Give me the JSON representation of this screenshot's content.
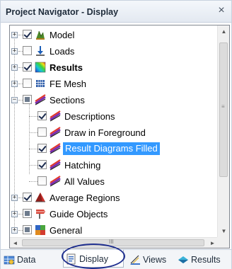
{
  "panel": {
    "title": "Project Navigator - Display",
    "close_glyph": "×"
  },
  "tree": {
    "items": [
      {
        "label": "Model",
        "state": "checked",
        "icon": "model-icon",
        "expander": "+"
      },
      {
        "label": "Loads",
        "state": "unchecked",
        "icon": "loads-icon",
        "expander": "+"
      },
      {
        "label": "Results",
        "state": "checked",
        "icon": "results-icon",
        "expander": "+"
      },
      {
        "label": "FE Mesh",
        "state": "unchecked",
        "icon": "fe-mesh-icon",
        "expander": "+"
      },
      {
        "label": "Sections",
        "state": "partial",
        "icon": "sections-icon",
        "expander": "−"
      },
      {
        "label": "Descriptions",
        "state": "checked",
        "icon": "section-item-icon"
      },
      {
        "label": "Draw in Foreground",
        "state": "unchecked",
        "icon": "section-item-icon"
      },
      {
        "label": "Result Diagrams Filled",
        "state": "checked",
        "icon": "section-item-icon",
        "selected": true
      },
      {
        "label": "Hatching",
        "state": "checked",
        "icon": "section-item-icon"
      },
      {
        "label": "All Values",
        "state": "unchecked",
        "icon": "section-item-icon"
      },
      {
        "label": "Average Regions",
        "state": "checked",
        "icon": "average-regions-icon",
        "expander": "+"
      },
      {
        "label": "Guide Objects",
        "state": "partial",
        "icon": "guide-objects-icon",
        "expander": "+"
      },
      {
        "label": "General",
        "state": "partial",
        "icon": "general-icon",
        "expander": "+"
      }
    ]
  },
  "scrollbars": {
    "vertical": {
      "up": "▲",
      "down": "▼",
      "grip": "≡"
    },
    "horizontal": {
      "left": "◄",
      "right": "►",
      "grip": "III"
    }
  },
  "tabs": [
    {
      "label": "Data",
      "icon": "data-icon",
      "active": false
    },
    {
      "label": "Display",
      "icon": "display-icon",
      "active": true
    },
    {
      "label": "Views",
      "icon": "views-icon",
      "active": false
    },
    {
      "label": "Results",
      "icon": "results-tab-icon",
      "active": false
    }
  ],
  "colors": {
    "selection": "#3399ff",
    "highlight_ellipse": "#1f2f8f"
  }
}
